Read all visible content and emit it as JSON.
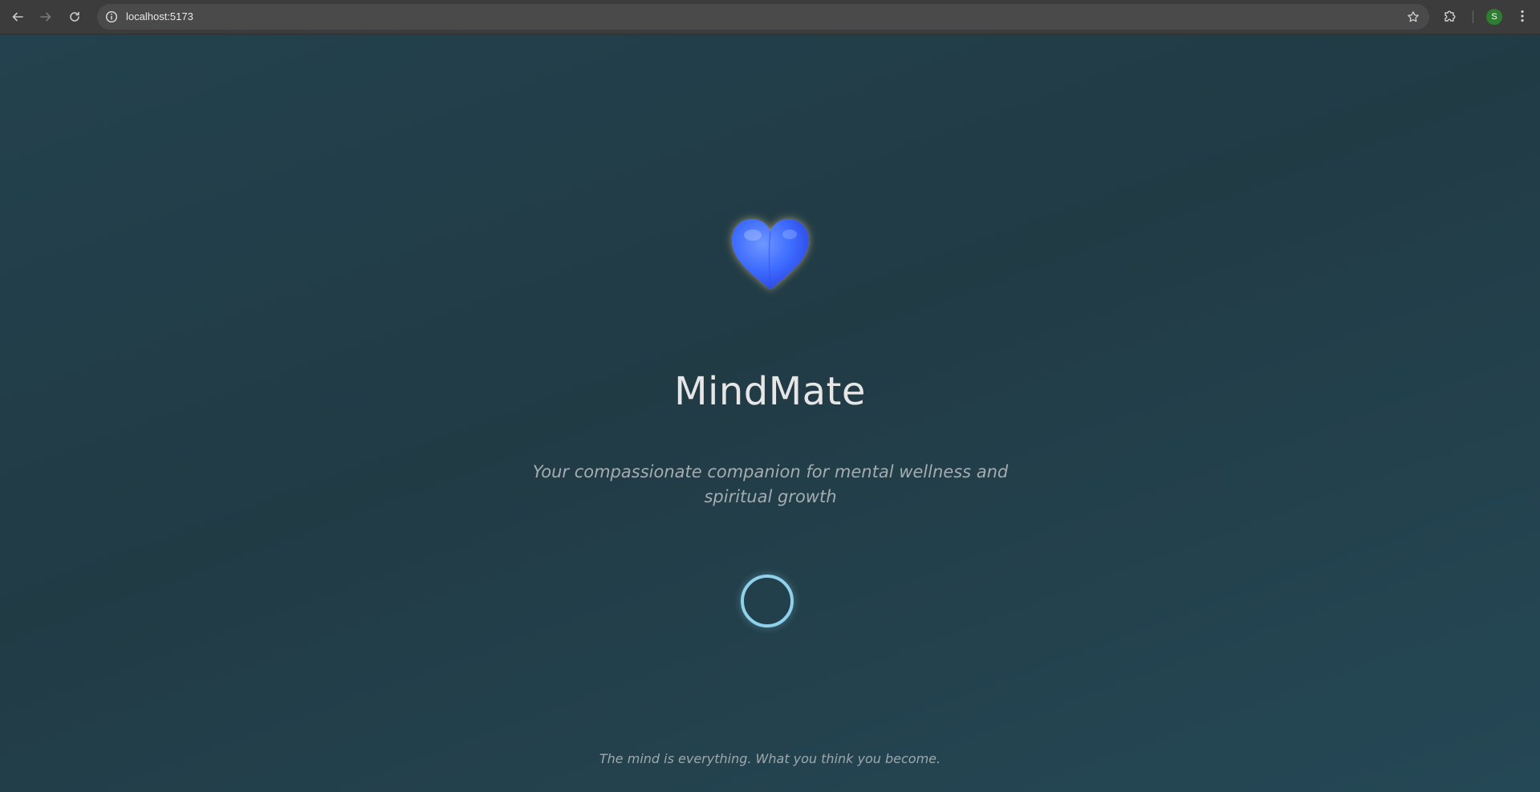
{
  "browser": {
    "url": "localhost:5173",
    "avatar_letter": "S",
    "avatar_color": "#2e7d32"
  },
  "page": {
    "logo_icon": "blue-heart-icon",
    "title": "MindMate",
    "subtitle": "Your compassionate companion for mental wellness and spiritual growth",
    "quote": "The mind is everything. What you think you become."
  },
  "colors": {
    "background": "#233f4a",
    "heart": "#3d6bff",
    "spinner": "#8fd0ea",
    "title": "#e6e6e6"
  }
}
